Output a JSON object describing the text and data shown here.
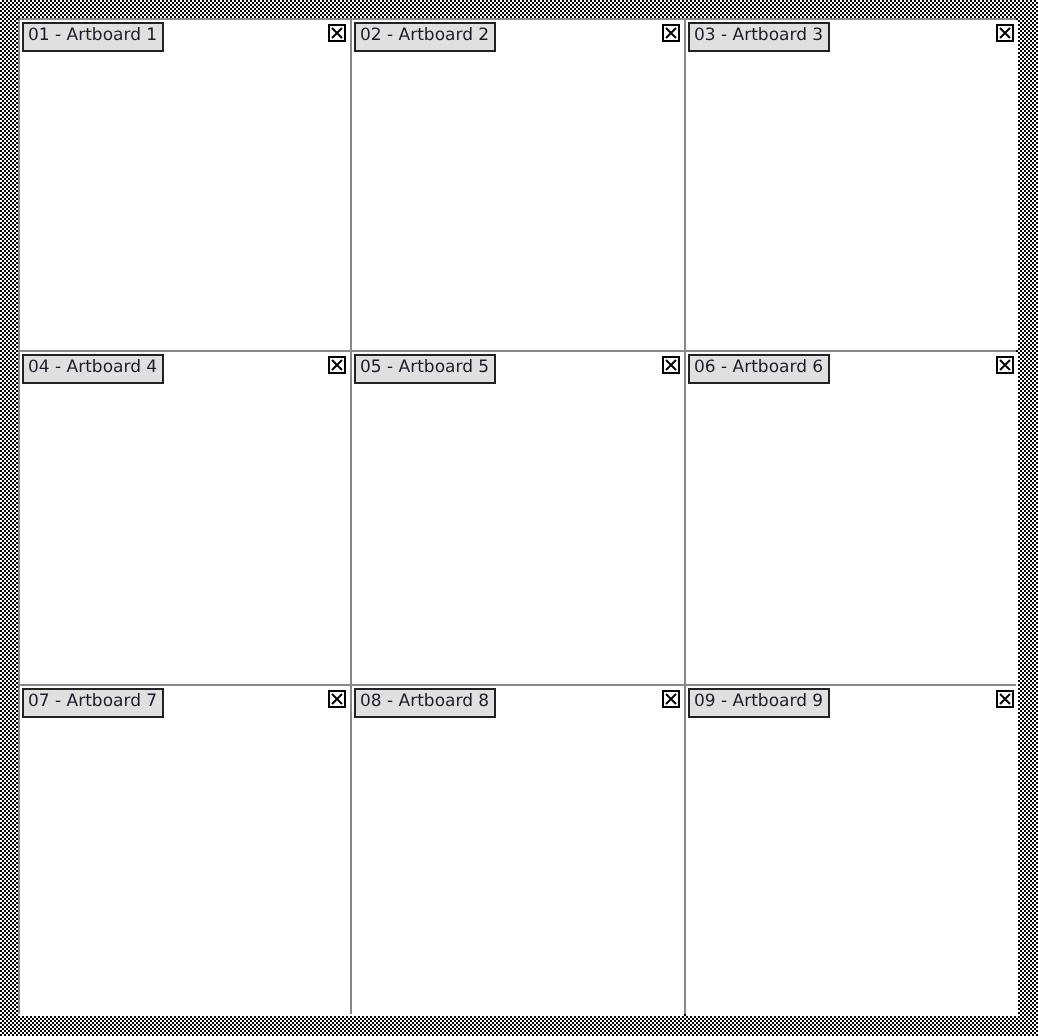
{
  "artboards": [
    {
      "label": "01 - Artboard 1"
    },
    {
      "label": "02 - Artboard 2"
    },
    {
      "label": "03 - Artboard 3"
    },
    {
      "label": "04 - Artboard 4"
    },
    {
      "label": "05 - Artboard 5"
    },
    {
      "label": "06 - Artboard 6"
    },
    {
      "label": "07 - Artboard 7"
    },
    {
      "label": "08 - Artboard 8"
    },
    {
      "label": "09 - Artboard 9"
    }
  ]
}
